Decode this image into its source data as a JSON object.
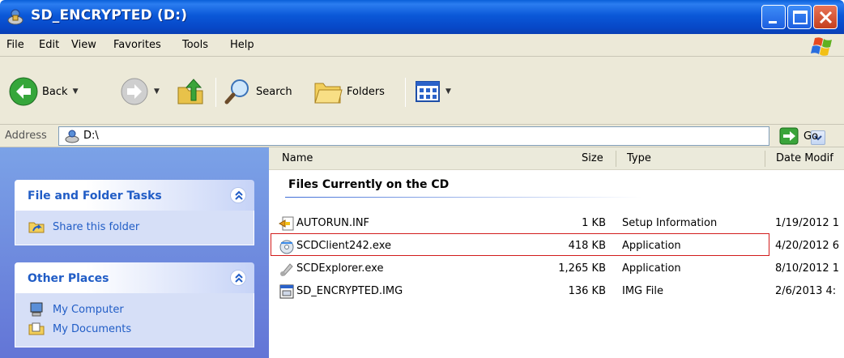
{
  "window": {
    "title": "SD_ENCRYPTED (D:)"
  },
  "menu": [
    "File",
    "Edit",
    "View",
    "Favorites",
    "Tools",
    "Help"
  ],
  "toolbar": {
    "back": "Back",
    "search": "Search",
    "folders": "Folders"
  },
  "address": {
    "label": "Address",
    "value": "D:\\",
    "go": "Go"
  },
  "tasks": {
    "file_folder": {
      "title": "File and Folder Tasks",
      "items": [
        "Share this folder"
      ]
    },
    "other_places": {
      "title": "Other Places",
      "items": [
        "My Computer",
        "My Documents"
      ]
    }
  },
  "columns": {
    "name": "Name",
    "size": "Size",
    "type": "Type",
    "date": "Date Modif"
  },
  "group_title": "Files Currently on the CD",
  "files": [
    {
      "name": "AUTORUN.INF",
      "size": "1 KB",
      "type": "Setup Information",
      "date": "1/19/2012 1",
      "icon": "setup-info-icon"
    },
    {
      "name": "SCDClient242.exe",
      "size": "418 KB",
      "type": "Application",
      "date": "4/20/2012 6",
      "icon": "app-disc-icon"
    },
    {
      "name": "SCDExplorer.exe",
      "size": "1,265 KB",
      "type": "Application",
      "date": "8/10/2012 1",
      "icon": "app-generic-icon"
    },
    {
      "name": "SD_ENCRYPTED.IMG",
      "size": "136 KB",
      "type": "IMG File",
      "date": "2/6/2013 4:",
      "icon": "img-file-icon"
    }
  ]
}
